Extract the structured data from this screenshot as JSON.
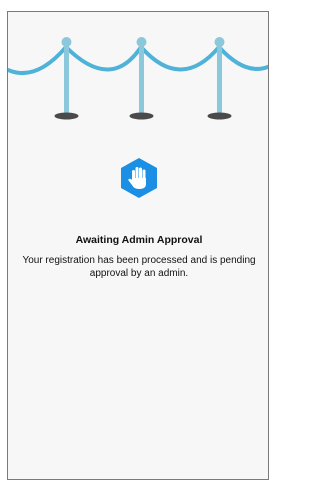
{
  "approval_screen": {
    "icon": "hand-stop-icon",
    "title": "Awaiting Admin Approval",
    "message": "Your registration has been processed and is pending approval by an admin."
  },
  "colors": {
    "accent": "#1a8fe3",
    "rope": "#4fb2d8",
    "post": "#8cc8db",
    "base": "#4a4a4a",
    "background": "#f7f7f7",
    "text": "#111111"
  }
}
